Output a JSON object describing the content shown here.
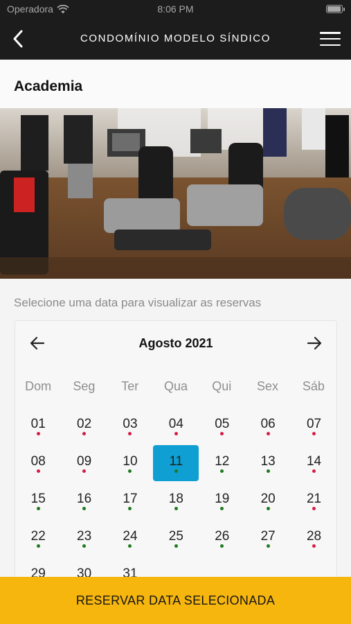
{
  "status_bar": {
    "carrier": "Operadora",
    "time": "8:06 PM"
  },
  "header": {
    "title": "CONDOMÍNIO MODELO SÍNDICO",
    "back_icon": "chevron-left-icon",
    "menu_icon": "hamburger-menu-icon"
  },
  "page": {
    "title": "Academia",
    "image_description": "gym-photo"
  },
  "reservation": {
    "hint": "Selecione uma data para visualizar as reservas"
  },
  "calendar": {
    "month_label": "Agosto 2021",
    "prev_icon": "arrow-left-icon",
    "next_icon": "arrow-right-icon",
    "weekdays": [
      "Dom",
      "Seg",
      "Ter",
      "Qua",
      "Qui",
      "Sex",
      "Sáb"
    ],
    "selected_day": "11",
    "status_colors": {
      "red": "#d81b46",
      "green": "#1f7a1f"
    },
    "selected_color": "#0f9fd3",
    "days": [
      {
        "label": "01",
        "dot": "red"
      },
      {
        "label": "02",
        "dot": "red"
      },
      {
        "label": "03",
        "dot": "red"
      },
      {
        "label": "04",
        "dot": "red"
      },
      {
        "label": "05",
        "dot": "red"
      },
      {
        "label": "06",
        "dot": "red"
      },
      {
        "label": "07",
        "dot": "red"
      },
      {
        "label": "08",
        "dot": "red"
      },
      {
        "label": "09",
        "dot": "red"
      },
      {
        "label": "10",
        "dot": "green"
      },
      {
        "label": "11",
        "dot": "green",
        "selected": true
      },
      {
        "label": "12",
        "dot": "green"
      },
      {
        "label": "13",
        "dot": "green"
      },
      {
        "label": "14",
        "dot": "red"
      },
      {
        "label": "15",
        "dot": "green"
      },
      {
        "label": "16",
        "dot": "green"
      },
      {
        "label": "17",
        "dot": "green"
      },
      {
        "label": "18",
        "dot": "green"
      },
      {
        "label": "19",
        "dot": "green"
      },
      {
        "label": "20",
        "dot": "green"
      },
      {
        "label": "21",
        "dot": "red"
      },
      {
        "label": "22",
        "dot": "green"
      },
      {
        "label": "23",
        "dot": "green"
      },
      {
        "label": "24",
        "dot": "green"
      },
      {
        "label": "25",
        "dot": "green"
      },
      {
        "label": "26",
        "dot": "green"
      },
      {
        "label": "27",
        "dot": "green"
      },
      {
        "label": "28",
        "dot": "red"
      },
      {
        "label": "29",
        "dot": "none"
      },
      {
        "label": "30",
        "dot": "none"
      },
      {
        "label": "31",
        "dot": "none"
      }
    ]
  },
  "footer": {
    "button_label": "RESERVAR DATA SELECIONADA",
    "button_color": "#f6b60e"
  }
}
